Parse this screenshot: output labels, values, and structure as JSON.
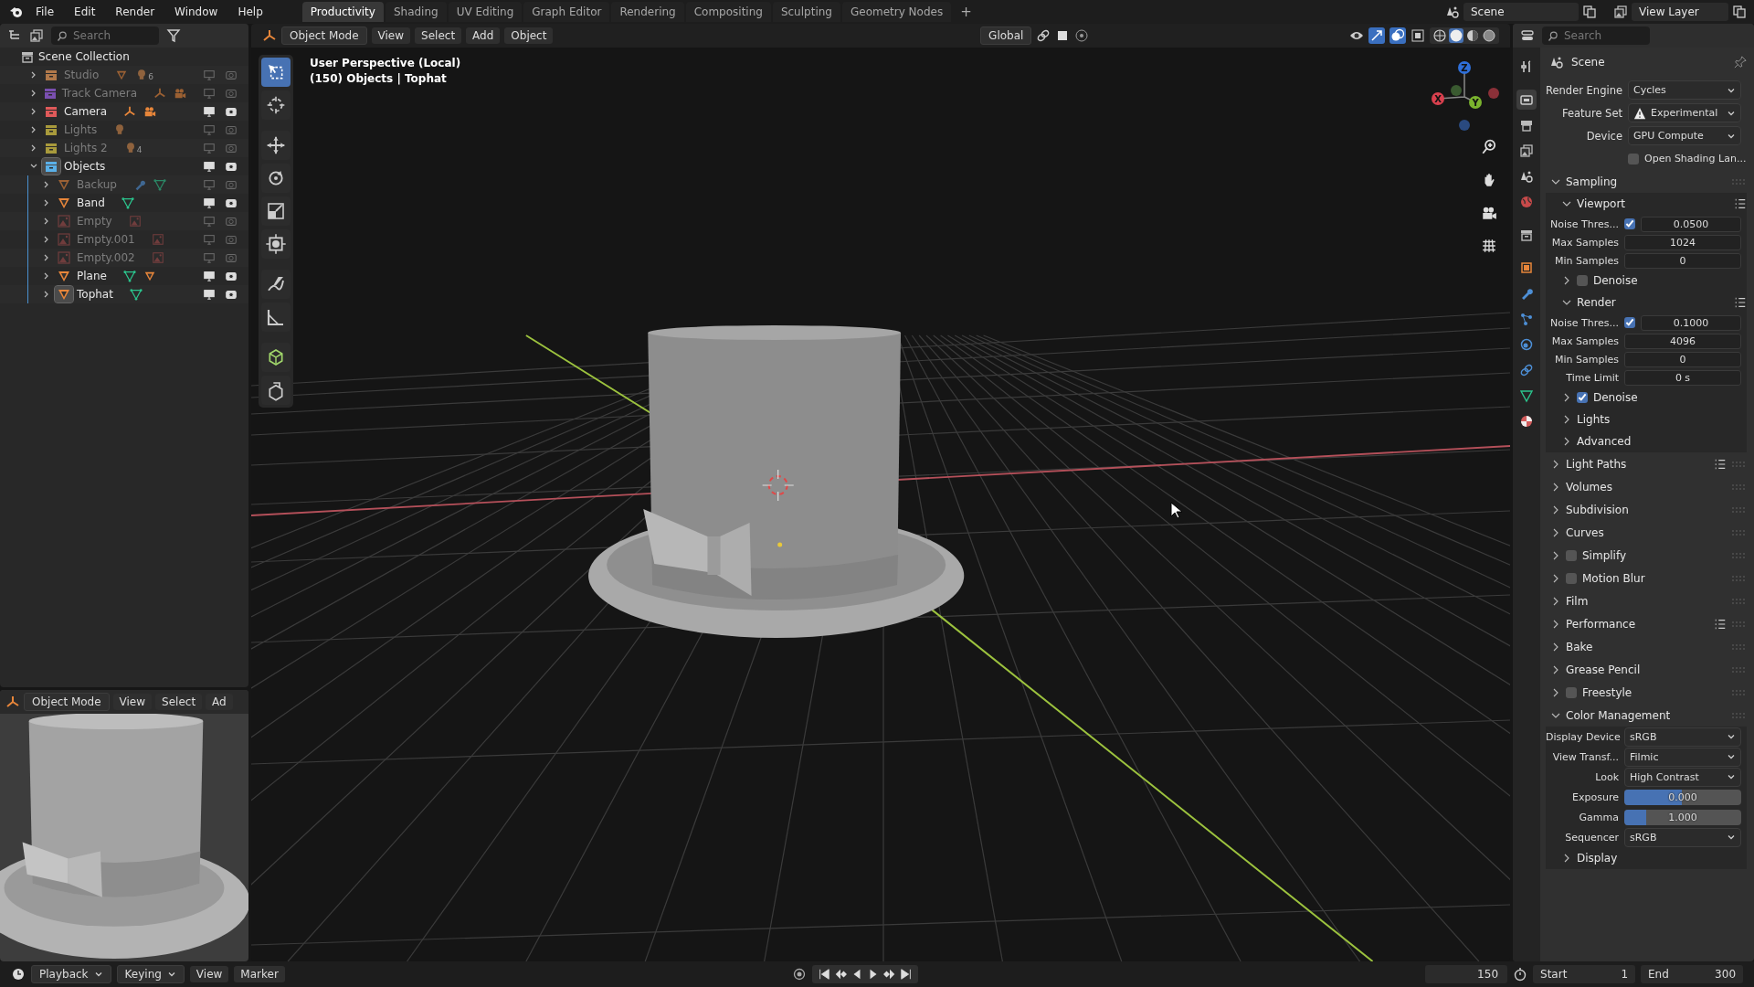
{
  "top_bar": {
    "menus": [
      "File",
      "Edit",
      "Render",
      "Window",
      "Help"
    ],
    "workspaces": [
      {
        "label": "Productivity",
        "selected": true
      },
      {
        "label": "Shading",
        "selected": false
      },
      {
        "label": "UV Editing",
        "selected": false
      },
      {
        "label": "Graph Editor",
        "selected": false
      },
      {
        "label": "Rendering",
        "selected": false
      },
      {
        "label": "Compositing",
        "selected": false
      },
      {
        "label": "Sculpting",
        "selected": false
      },
      {
        "label": "Geometry Nodes",
        "selected": false
      }
    ],
    "add_workspace": "+",
    "scene": "Scene",
    "view_layer": "View Layer"
  },
  "outliner": {
    "search": {
      "placeholder": "Search"
    },
    "root": "Scene Collection",
    "items": [
      {
        "name": "Studio",
        "kind": "collection",
        "color": "#b0784a",
        "hidden": true,
        "active": false,
        "expanded": false,
        "icons": [
          {
            "kind": "mesh"
          },
          {
            "kind": "light",
            "count": "6"
          }
        ]
      },
      {
        "name": "Track Camera",
        "kind": "collection",
        "color": "#7a4fb0",
        "hidden": true,
        "active": false,
        "expanded": false,
        "icons": [
          {
            "kind": "empty-axes"
          },
          {
            "kind": "camera"
          }
        ]
      },
      {
        "name": "Camera",
        "kind": "collection",
        "color": "#e05a5a",
        "hidden": false,
        "active": false,
        "expanded": false,
        "icons": [
          {
            "kind": "empty-axes"
          },
          {
            "kind": "camera"
          }
        ]
      },
      {
        "name": "Lights",
        "kind": "collection",
        "color": "#a89a3c",
        "hidden": true,
        "active": false,
        "expanded": false,
        "icons": [
          {
            "kind": "light"
          }
        ]
      },
      {
        "name": "Lights 2",
        "kind": "collection",
        "color": "#a89a3c",
        "hidden": true,
        "active": false,
        "expanded": false,
        "icons": [
          {
            "kind": "light",
            "count": "4"
          }
        ]
      },
      {
        "name": "Objects",
        "kind": "collection",
        "color": "#5ab0e8",
        "hidden": false,
        "active": true,
        "expanded": true,
        "children": [
          {
            "name": "Backup",
            "kind": "mesh",
            "hidden": true,
            "active": false,
            "expanded": false,
            "icons": [
              {
                "kind": "modifier"
              },
              {
                "kind": "meshdata"
              }
            ]
          },
          {
            "name": "Band",
            "kind": "mesh",
            "hidden": false,
            "active": false,
            "expanded": false,
            "icons": [
              {
                "kind": "meshdata"
              }
            ]
          },
          {
            "name": "Empty",
            "kind": "image",
            "hidden": true,
            "active": false,
            "expanded": false,
            "icons": [
              {
                "kind": "image"
              }
            ]
          },
          {
            "name": "Empty.001",
            "kind": "image",
            "hidden": true,
            "active": false,
            "expanded": false,
            "icons": [
              {
                "kind": "image"
              }
            ]
          },
          {
            "name": "Empty.002",
            "kind": "image",
            "hidden": true,
            "active": false,
            "expanded": false,
            "icons": [
              {
                "kind": "image"
              }
            ]
          },
          {
            "name": "Plane",
            "kind": "mesh",
            "hidden": false,
            "active": false,
            "expanded": false,
            "icons": [
              {
                "kind": "meshdata"
              },
              {
                "kind": "mesh"
              }
            ]
          },
          {
            "name": "Tophat",
            "kind": "mesh",
            "hidden": false,
            "active": true,
            "expanded": false,
            "icons": [
              {
                "kind": "meshdata"
              }
            ]
          }
        ]
      }
    ]
  },
  "mini_viewport": {
    "mode": "Object Mode",
    "menus": [
      "View",
      "Select",
      "Ad"
    ]
  },
  "viewport": {
    "mode": "Object Mode",
    "menus": [
      "View",
      "Select",
      "Add",
      "Object"
    ],
    "orientation": "Global",
    "shading_modes": [
      {
        "kind": "wireframe",
        "selected": false
      },
      {
        "kind": "solid",
        "selected": true
      },
      {
        "kind": "material",
        "selected": false
      },
      {
        "kind": "rendered",
        "selected": false
      }
    ],
    "overlay_lines": [
      "User Perspective (Local)",
      "(150) Objects | Tophat"
    ],
    "axes": [
      "X",
      "Y",
      "Z"
    ],
    "tools": [
      {
        "kind": "select",
        "selected": true
      },
      {
        "kind": "cursor",
        "selected": false
      },
      {
        "kind": "move",
        "selected": false
      },
      {
        "kind": "rotate",
        "selected": false
      },
      {
        "kind": "scale",
        "selected": false
      },
      {
        "kind": "transform",
        "selected": false
      },
      {
        "kind": "annotate",
        "selected": false
      },
      {
        "kind": "measure",
        "selected": false
      },
      {
        "kind": "add-cube",
        "selected": false
      },
      {
        "kind": "extrude",
        "selected": false
      }
    ]
  },
  "properties": {
    "search": {
      "placeholder": "Search"
    },
    "title": "Scene",
    "tabs": [
      {
        "kind": "tool",
        "selected": false
      },
      {
        "kind": "render",
        "selected": true
      },
      {
        "kind": "output",
        "selected": false
      },
      {
        "kind": "view-layer",
        "selected": false
      },
      {
        "kind": "scene",
        "selected": false
      },
      {
        "kind": "world",
        "selected": false
      },
      {
        "kind": "collection",
        "selected": false
      },
      {
        "kind": "object",
        "selected": false
      },
      {
        "kind": "modifier",
        "selected": false
      },
      {
        "kind": "particles",
        "selected": false
      },
      {
        "kind": "physics",
        "selected": false
      },
      {
        "kind": "constraints",
        "selected": false
      },
      {
        "kind": "data",
        "selected": false
      },
      {
        "kind": "material",
        "selected": false
      }
    ],
    "rows": [
      {
        "kind": "dropdown",
        "label": "Render Engine",
        "value": "Cycles"
      },
      {
        "kind": "dropdown",
        "label": "Feature Set",
        "value": "Experimental",
        "warning": true
      },
      {
        "kind": "dropdown",
        "label": "Device",
        "value": "GPU Compute"
      },
      {
        "kind": "checkbox",
        "label": "Open Shading Lan...",
        "checked": false
      }
    ],
    "panels": [
      {
        "title": "Sampling",
        "expanded": true,
        "children": [
          {
            "title": "Viewport",
            "expanded": true,
            "presets": true,
            "rows": [
              {
                "kind": "number-check",
                "label": "Noise Thres...",
                "checked": true,
                "value": "0.0500"
              },
              {
                "kind": "number",
                "label": "Max Samples",
                "value": "1024"
              },
              {
                "kind": "number",
                "label": "Min Samples",
                "value": "0"
              }
            ],
            "children": [
              {
                "title": "Denoise",
                "expanded": false,
                "checked": false
              }
            ]
          },
          {
            "title": "Render",
            "expanded": true,
            "presets": true,
            "rows": [
              {
                "kind": "number-check",
                "label": "Noise Thres...",
                "checked": true,
                "value": "0.1000"
              },
              {
                "kind": "number",
                "label": "Max Samples",
                "value": "4096"
              },
              {
                "kind": "number",
                "label": "Min Samples",
                "value": "0"
              },
              {
                "kind": "number",
                "label": "Time Limit",
                "value": "0 s"
              }
            ],
            "children": [
              {
                "title": "Denoise",
                "expanded": false,
                "checked": true
              }
            ]
          },
          {
            "title": "Lights",
            "expanded": false
          },
          {
            "title": "Advanced",
            "expanded": false
          }
        ]
      },
      {
        "title": "Light Paths",
        "expanded": false,
        "presets": true
      },
      {
        "title": "Volumes",
        "expanded": false
      },
      {
        "title": "Subdivision",
        "expanded": false
      },
      {
        "title": "Curves",
        "expanded": false
      },
      {
        "title": "Simplify",
        "expanded": false,
        "checked": false
      },
      {
        "title": "Motion Blur",
        "expanded": false,
        "checked": false
      },
      {
        "title": "Film",
        "expanded": false
      },
      {
        "title": "Performance",
        "expanded": false,
        "presets": true
      },
      {
        "title": "Bake",
        "expanded": false
      },
      {
        "title": "Grease Pencil",
        "expanded": false
      },
      {
        "title": "Freestyle",
        "expanded": false,
        "checked": false
      },
      {
        "title": "Color Management",
        "expanded": true,
        "rows": [
          {
            "kind": "dropdown",
            "label": "Display Device",
            "value": "sRGB"
          },
          {
            "kind": "dropdown",
            "label": "View Transf...",
            "value": "Filmic"
          },
          {
            "kind": "dropdown",
            "label": "Look",
            "value": "High Contrast"
          },
          {
            "kind": "slider",
            "label": "Exposure",
            "value": "0.000",
            "level": 0.49
          },
          {
            "kind": "slider",
            "label": "Gamma",
            "value": "1.000",
            "level": 0.19
          },
          {
            "kind": "dropdown",
            "label": "Sequencer",
            "value": "sRGB"
          }
        ],
        "children": [
          {
            "title": "Display",
            "expanded": false
          }
        ]
      }
    ]
  },
  "timeline": {
    "menus": [
      {
        "label": "Playback",
        "dropdown": true
      },
      {
        "label": "Keying",
        "dropdown": true
      },
      {
        "label": "View",
        "dropdown": false
      },
      {
        "label": "Marker",
        "dropdown": false
      }
    ],
    "current_frame": "150",
    "start_label": "Start",
    "start": "1",
    "end_label": "End",
    "end": "300"
  }
}
